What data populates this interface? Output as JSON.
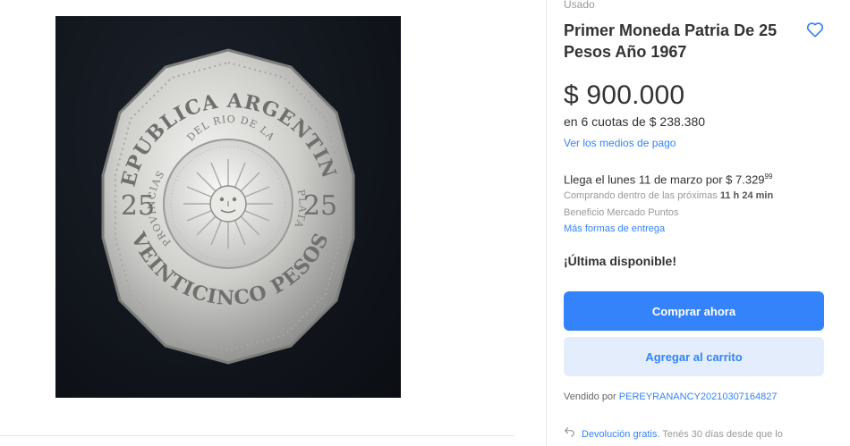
{
  "product": {
    "condition": "Usado",
    "title": "Primer Moneda Patria De 25 Pesos Año 1967",
    "price": "$ 900.000",
    "installments": "en 6 cuotas de $ 238.380",
    "payment_link": "Ver los medios de pago",
    "stock_note": "¡Última disponible!"
  },
  "coin": {
    "top_text": "REPUBLICA ARGENTINA",
    "bottom_text": "VEINTICINCO PESOS",
    "inner_top": "DEL RIO DE LA",
    "inner_left": "PROVINCIAS",
    "inner_right": "PLATA",
    "value_left": "25",
    "value_right": "25"
  },
  "delivery": {
    "arrival_prefix": "Llega el lunes 11 de marzo por ",
    "arrival_price": "$ 7.329",
    "arrival_cents": "99",
    "time_prefix": "Comprando dentro de las próximas ",
    "time_bold": "11 h 24 min",
    "points": "Beneficio Mercado Puntos",
    "more_link": "Más formas de entrega"
  },
  "actions": {
    "buy_label": "Comprar ahora",
    "cart_label": "Agregar al carrito"
  },
  "seller": {
    "prefix": "Vendido por ",
    "name": "PEREYRANANCY20210307164827"
  },
  "returns": {
    "link": "Devolución gratis.",
    "text": " Tenés 30 días desde que lo"
  },
  "icons": {
    "favorite": "heart-outline-icon",
    "returns": "return-arrow-icon"
  },
  "colors": {
    "accent": "#3483fa",
    "accent_light": "#e3edfb",
    "text_primary": "#333333",
    "text_muted": "#999999"
  }
}
